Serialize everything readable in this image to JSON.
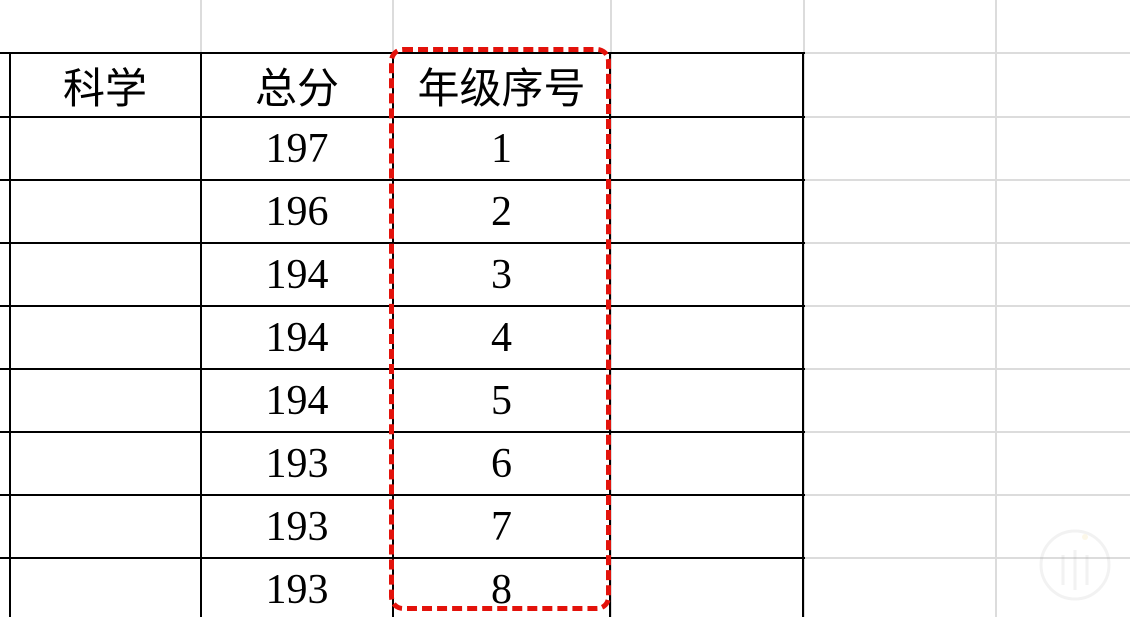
{
  "table": {
    "headers": [
      "科学",
      "总分",
      "年级序号"
    ],
    "rows": [
      {
        "total": "197",
        "rank": "1"
      },
      {
        "total": "196",
        "rank": "2"
      },
      {
        "total": "194",
        "rank": "3"
      },
      {
        "total": "194",
        "rank": "4"
      },
      {
        "total": "194",
        "rank": "5"
      },
      {
        "total": "193",
        "rank": "6"
      },
      {
        "total": "193",
        "rank": "7"
      },
      {
        "total": "193",
        "rank": "8"
      }
    ]
  },
  "colors": {
    "gridline": "#dcdcdc",
    "border": "#000000",
    "highlight": "#e3120b"
  }
}
